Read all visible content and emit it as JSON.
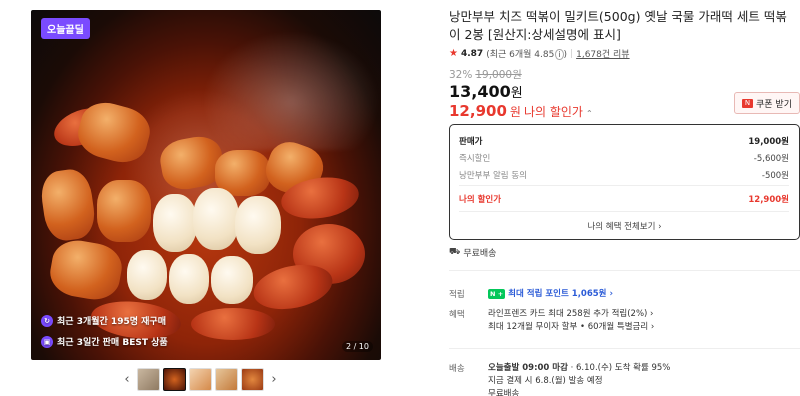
{
  "gallery": {
    "badge": "오늘끝딜",
    "promo_1": "최근 3개월간 195명 재구매",
    "promo_2": "최근 3일간 판매 BEST 상품",
    "counter": "2 / 10",
    "thumb_count": 5,
    "prev_icon": "chevron-left-icon",
    "next_icon": "chevron-right-icon"
  },
  "product": {
    "title": "낭만부부 치즈 떡볶이 밀키트(500g) 옛날 국물 가래떡 세트 떡볶이 2봉 [원산지:상세설명에 표시]",
    "rating_score": "4.87",
    "rating_detail": "(최근 6개월 4.85",
    "rating_detail_close": ")",
    "reviews": "1,678건 리뷰",
    "discount_rate": "32%",
    "original_price": "19,000원",
    "price": "13,400",
    "price_unit": "원",
    "sale_price": "12,900",
    "sale_unit": "원",
    "sale_label": "나의 할인가",
    "coupon_label": "쿠폰 받기"
  },
  "price_box": {
    "list_price_label": "판매가",
    "list_price": "19,000원",
    "instant_label": "즉시할인",
    "instant_value": "-5,600원",
    "alarm_label": "낭만부부 알림 동의",
    "alarm_value": "-500원",
    "mine_label": "나의 할인가",
    "mine_value": "12,900원",
    "benefit_all": "나의 혜택 전체보기 ›"
  },
  "shipping": {
    "free_label": "무료배송"
  },
  "info": {
    "points_key": "적립",
    "points_badge": "N +",
    "points_text": "최대 적립 포인트 1,065원 ›",
    "benefit_key": "혜택",
    "benefit_line1": "라인프렌즈 카드 최대 258원 추가 적립(2%) ›",
    "benefit_line2": "최대 12개월 무이자 할부 • 60개월 특별금리 ›",
    "delivery_key": "배송",
    "delivery_bold": "오늘출발 09:00 마감",
    "delivery_rest": " · 6.10.(수) 도착 확률 95%",
    "delivery_line2": "지금 결제 시 6.8.(월) 발송 예정",
    "delivery_line3": "무료배송"
  },
  "colors": {
    "accent_red": "#e8382e",
    "badge_purple": "#7a4bff",
    "naver_green": "#03c75a",
    "link_blue": "#2b5bd7"
  }
}
